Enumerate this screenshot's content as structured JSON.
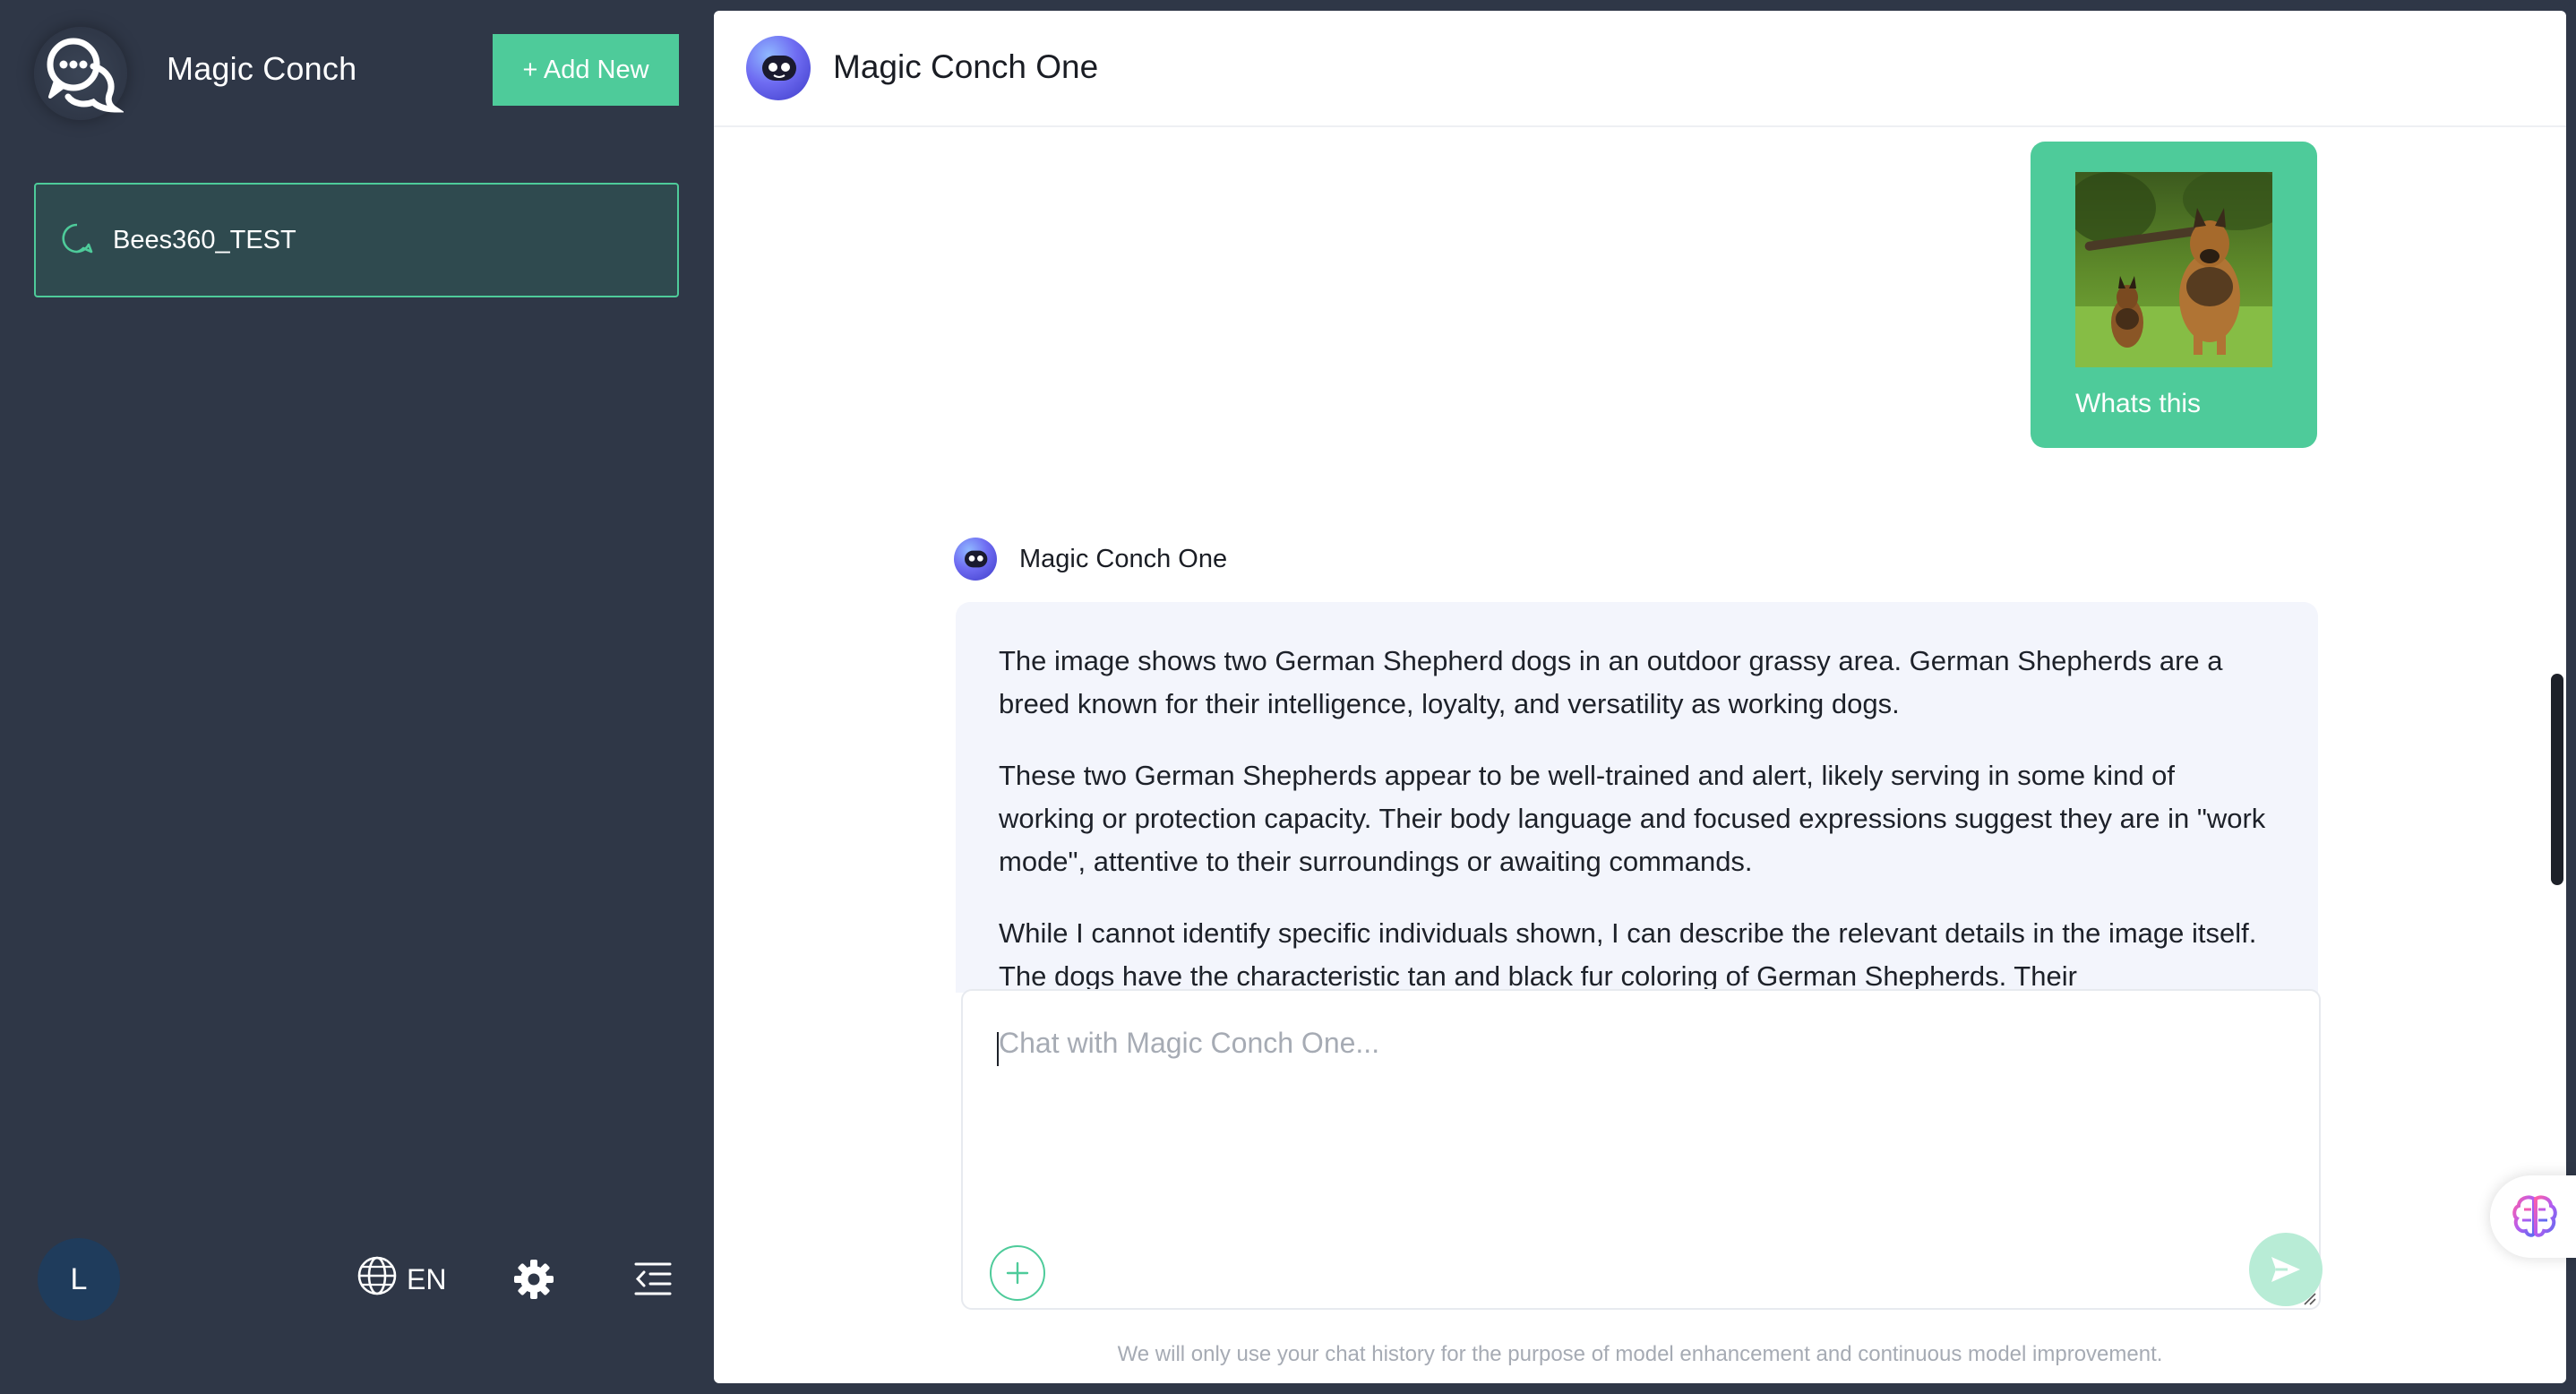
{
  "app": {
    "title": "Magic Conch",
    "add_new_label": "+ Add New"
  },
  "sidebar": {
    "conversations": [
      {
        "label": "Bees360_TEST",
        "active": true
      }
    ],
    "user_initial": "L",
    "language_label": "EN",
    "icons": [
      "chat-bubble-logo-icon",
      "chat-bubble-outline-icon",
      "globe-icon",
      "gear-icon",
      "collapse-menu-icon"
    ]
  },
  "chat": {
    "header_title": "Magic Conch One",
    "user_message": {
      "caption": "Whats this",
      "image_semantic": "two-german-shepherds-photo"
    },
    "assistant_name": "Magic Conch One",
    "assistant_paragraphs": [
      "The image shows two German Shepherd dogs in an outdoor grassy area. German Shepherds are a breed known for their intelligence, loyalty, and versatility as working dogs.",
      "These two German Shepherds appear to be well-trained and alert, likely serving in some kind of working or protection capacity. Their body language and focused expressions suggest they are in \"work mode\", attentive to their surroundings or awaiting commands.",
      "While I cannot identify specific individuals shown, I can describe the relevant details in the image itself. The dogs have the characteristic tan and black fur coloring of German Shepherds. Their"
    ],
    "input_placeholder": "Chat with Magic Conch One...",
    "disclaimer": "We will only use your chat history for the purpose of model enhancement and continuous model improvement."
  },
  "colors": {
    "sidebar_bg": "#2f3747",
    "accent": "#4ecb9a",
    "assistant_bubble": "#f3f5fc",
    "send_disabled": "#b8ecd6"
  }
}
